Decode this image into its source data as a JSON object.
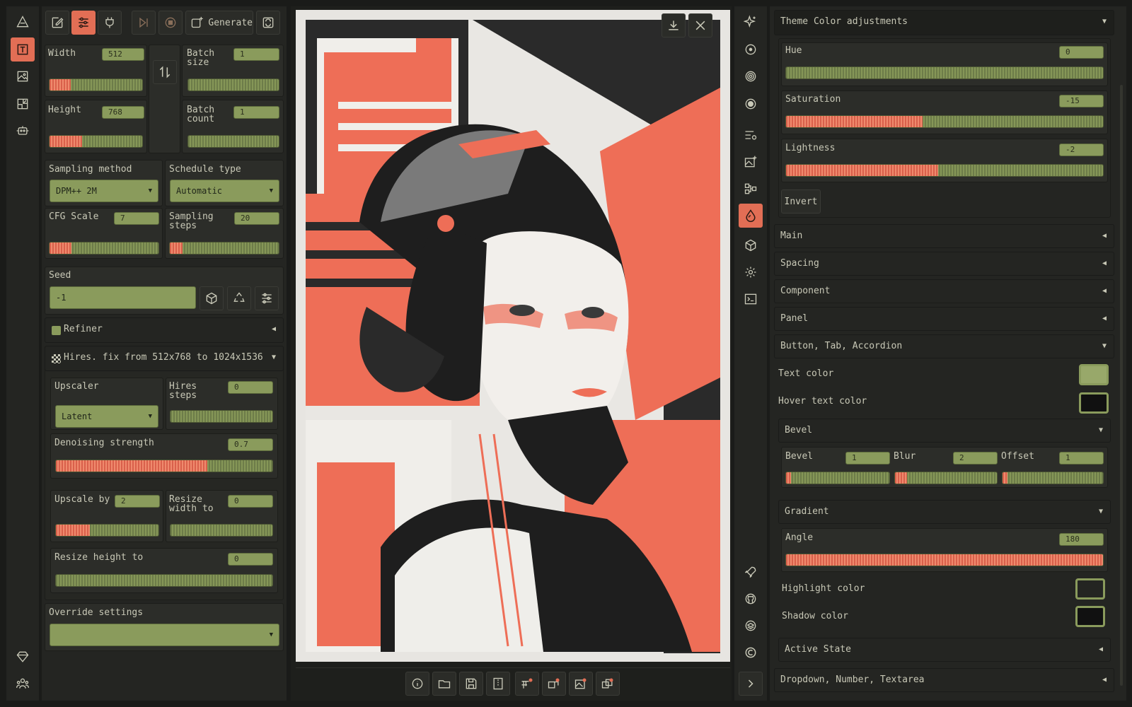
{
  "colors": {
    "accent": "#e26e55",
    "olive": "#8a9b5c",
    "bg": "#1a1b19"
  },
  "left_rail": {
    "icons": [
      "logo-icon",
      "text-to-image-icon",
      "image-to-image-icon",
      "extras-icon",
      "robot-icon",
      "diamond-icon",
      "people-icon"
    ]
  },
  "toolbar": {
    "generate_label": "Generate"
  },
  "params": {
    "width_label": "Width",
    "width_value": "512",
    "height_label": "Height",
    "height_value": "768",
    "batch_size_label": "Batch size",
    "batch_size_value": "1",
    "batch_count_label": "Batch count",
    "batch_count_value": "1",
    "sampling_method_label": "Sampling method",
    "sampling_method_value": "DPM++ 2M",
    "schedule_type_label": "Schedule type",
    "schedule_type_value": "Automatic",
    "cfg_label": "CFG Scale",
    "cfg_value": "7",
    "steps_label": "Sampling steps",
    "steps_value": "20",
    "seed_label": "Seed",
    "seed_value": "-1",
    "refiner_label": "Refiner",
    "hires_label": "Hires. fix from 512x768 to 1024x1536",
    "upscaler_label": "Upscaler",
    "upscaler_value": "Latent",
    "hires_steps_label": "Hires steps",
    "hires_steps_value": "0",
    "denoise_label": "Denoising strength",
    "denoise_value": "0.7",
    "upscale_by_label": "Upscale by",
    "upscale_by_value": "2",
    "resize_w_label": "Resize width to",
    "resize_w_value": "0",
    "resize_h_label": "Resize height to",
    "resize_h_value": "0",
    "override_label": "Override settings"
  },
  "levels": {
    "width": 0.23,
    "height": 0.35,
    "cfg": 0.2,
    "steps": 0.12,
    "denoise": 0.7,
    "upscale_by": 0.33,
    "saturation": 0.43,
    "lightness": 0.48,
    "bevel": 0.05,
    "blur": 0.12,
    "offset": 0.05,
    "angle": 1.0
  },
  "theme": {
    "theme_color_label": "Theme Color adjustments",
    "hue_label": "Hue",
    "hue_value": "0",
    "saturation_label": "Saturation",
    "saturation_value": "-15",
    "lightness_label": "Lightness",
    "lightness_value": "-2",
    "invert_label": "Invert",
    "main_label": "Main",
    "spacing_label": "Spacing",
    "component_label": "Component",
    "panel_label": "Panel",
    "button_label": "Button, Tab, Accordion",
    "text_color_label": "Text color",
    "hover_text_color_label": "Hover text color",
    "bevel_section_label": "Bevel",
    "bevel_label": "Bevel",
    "bevel_value": "1",
    "blur_label": "Blur",
    "blur_value": "2",
    "offset_label": "Offset",
    "offset_value": "1",
    "gradient_label": "Gradient",
    "angle_label": "Angle",
    "angle_value": "180",
    "highlight_label": "Highlight color",
    "shadow_label": "Shadow color",
    "active_state_label": "Active State",
    "dropdown_label": "Dropdown, Number, Textarea"
  }
}
